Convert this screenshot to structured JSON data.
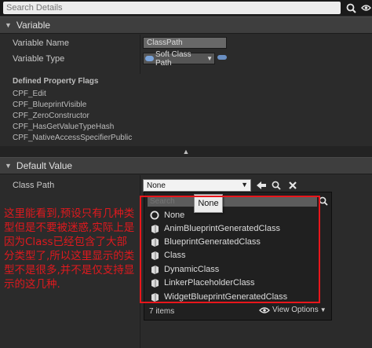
{
  "search": {
    "placeholder": "Search Details"
  },
  "sections": {
    "variable": "Variable",
    "default_value": "Default Value"
  },
  "variable": {
    "name_label": "Variable Name",
    "name_value": "ClassPath",
    "type_label": "Variable Type",
    "type_value": "Soft Class Path"
  },
  "flags": {
    "title": "Defined Property Flags",
    "items": [
      "CPF_Edit",
      "CPF_BlueprintVisible",
      "CPF_ZeroConstructor",
      "CPF_HasGetValueTypeHash",
      "CPF_NativeAccessSpecifierPublic"
    ]
  },
  "default_value": {
    "class_path_label": "Class Path",
    "class_path_value": "None"
  },
  "picker": {
    "search_placeholder": "Search",
    "none_item": "None",
    "tooltip": "None",
    "items": [
      "AnimBlueprintGeneratedClass",
      "BlueprintGeneratedClass",
      "Class",
      "DynamicClass",
      "LinkerPlaceholderClass",
      "WidgetBlueprintGeneratedClass"
    ],
    "count": "7 items",
    "view_options": "View Options"
  },
  "annotation": {
    "text": "这里能看到,预设只有几种类型但是不要被迷惑,实际上是因为Class已经包含了大部分类型了,所以这里显示的类型不是很多,并不是仅支持显示的这几种.",
    "color": "#e8161b"
  },
  "colors": {
    "panel_bg": "#2b2b2b",
    "header_bg": "#3e3e3e",
    "pin_blue": "#7aa3d9"
  }
}
